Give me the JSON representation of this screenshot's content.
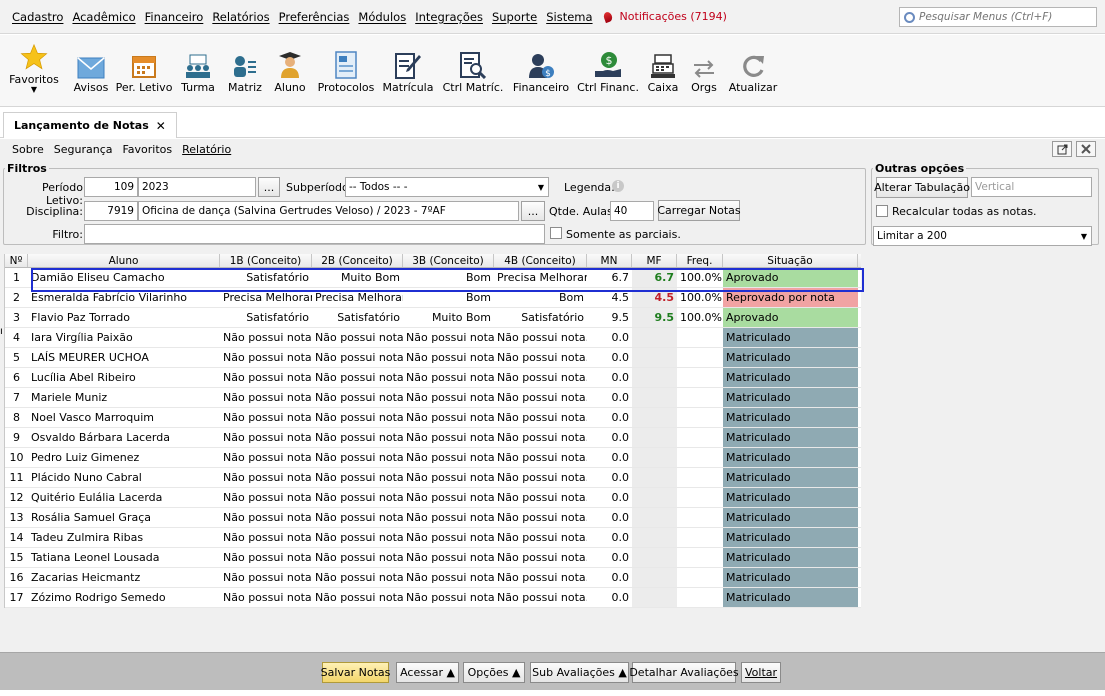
{
  "menu": {
    "items": [
      "Cadastro",
      "Acadêmico",
      "Financeiro",
      "Relatórios",
      "Preferências",
      "Módulos",
      "Integrações",
      "Suporte",
      "Sistema"
    ],
    "notifications": "Notificações (7194)",
    "search_placeholder": "Pesquisar Menus (Ctrl+F)"
  },
  "toolbar": {
    "items": [
      "Favoritos",
      "Avisos",
      "Per. Letivo",
      "Turma",
      "Matriz",
      "Aluno",
      "Protocolos",
      "Matrícula",
      "Ctrl Matríc.",
      "Financeiro",
      "Ctrl Financ.",
      "Caixa",
      "Orgs",
      "Atualizar"
    ]
  },
  "tab": {
    "label": "Lançamento de Notas",
    "close": "✕"
  },
  "submenu": [
    "Sobre",
    "Segurança",
    "Favoritos",
    "Relatório"
  ],
  "filters": {
    "legend": "Filtros",
    "periodo_label": "Período Letivo:",
    "periodo_code": "109",
    "periodo_value": "2023",
    "ellipsis": "...",
    "subperiodo_label": "Subperíodo:",
    "subperiodo_value": "-- Todos -- -",
    "legenda_label": "Legenda:",
    "disciplina_label": "Disciplina:",
    "disciplina_code": "7919",
    "disciplina_value": "Oficina de dança (Salvina Gertrudes Veloso) / 2023 - 7ºAF",
    "qtde_label": "Qtde. Aulas:",
    "qtde_value": "40",
    "carregar_label": "Carregar Notas",
    "filtro_label": "Filtro:",
    "somente_label": "Somente as parciais."
  },
  "options": {
    "legend": "Outras opções",
    "alterar_label": "Alterar Tabulação",
    "vertical_placeholder": "Vertical",
    "recalcular_label": "Recalcular todas as notas.",
    "limitar_value": "Limitar a 200"
  },
  "grid": {
    "headers": [
      "Nº",
      "Aluno",
      "1B (Conceito)",
      "2B (Conceito)",
      "3B (Conceito)",
      "4B (Conceito)",
      "MN",
      "MF",
      "Freq.",
      "Situação"
    ],
    "rows": [
      [
        "1",
        "Damião Eliseu Camacho",
        "Satisfatório",
        "Muito Bom",
        "Bom",
        "Precisa Melhorar",
        "6.7",
        "6.7",
        "100.0%",
        "Aprovado",
        "ok"
      ],
      [
        "2",
        "Esmeralda Fabrício Vilarinho",
        "Precisa Melhorar",
        "Precisa Melhorar",
        "Bom",
        "Bom",
        "4.5",
        "4.5",
        "100.0%",
        "Reprovado por nota",
        "fail"
      ],
      [
        "3",
        "Flavio Paz Torrado",
        "Satisfatório",
        "Satisfatório",
        "Muito Bom",
        "Satisfatório",
        "9.5",
        "9.5",
        "100.0%",
        "Aprovado",
        "ok"
      ],
      [
        "4",
        "Iara Virgília Paixão",
        "Não possui nota.",
        "Não possui nota.",
        "Não possui nota.",
        "Não possui nota.",
        "0.0",
        "",
        "",
        "Matriculado",
        "mat"
      ],
      [
        "5",
        "LAÍS MEURER UCHOA",
        "Não possui nota.",
        "Não possui nota.",
        "Não possui nota.",
        "Não possui nota.",
        "0.0",
        "",
        "",
        "Matriculado",
        "mat"
      ],
      [
        "6",
        "Lucília Abel Ribeiro",
        "Não possui nota.",
        "Não possui nota.",
        "Não possui nota.",
        "Não possui nota.",
        "0.0",
        "",
        "",
        "Matriculado",
        "mat"
      ],
      [
        "7",
        "Mariele Muniz",
        "Não possui nota.",
        "Não possui nota.",
        "Não possui nota.",
        "Não possui nota.",
        "0.0",
        "",
        "",
        "Matriculado",
        "mat"
      ],
      [
        "8",
        "Noel Vasco Marroquim",
        "Não possui nota.",
        "Não possui nota.",
        "Não possui nota.",
        "Não possui nota.",
        "0.0",
        "",
        "",
        "Matriculado",
        "mat"
      ],
      [
        "9",
        "Osvaldo Bárbara Lacerda",
        "Não possui nota.",
        "Não possui nota.",
        "Não possui nota.",
        "Não possui nota.",
        "0.0",
        "",
        "",
        "Matriculado",
        "mat"
      ],
      [
        "10",
        "Pedro Luiz Gimenez",
        "Não possui nota.",
        "Não possui nota.",
        "Não possui nota.",
        "Não possui nota.",
        "0.0",
        "",
        "",
        "Matriculado",
        "mat"
      ],
      [
        "11",
        "Plácido Nuno Cabral",
        "Não possui nota.",
        "Não possui nota.",
        "Não possui nota.",
        "Não possui nota.",
        "0.0",
        "",
        "",
        "Matriculado",
        "mat"
      ],
      [
        "12",
        "Quitério Eulália Lacerda",
        "Não possui nota.",
        "Não possui nota.",
        "Não possui nota.",
        "Não possui nota.",
        "0.0",
        "",
        "",
        "Matriculado",
        "mat"
      ],
      [
        "13",
        "Rosália Samuel Graça",
        "Não possui nota.",
        "Não possui nota.",
        "Não possui nota.",
        "Não possui nota.",
        "0.0",
        "",
        "",
        "Matriculado",
        "mat"
      ],
      [
        "14",
        "Tadeu Zulmira Ribas",
        "Não possui nota.",
        "Não possui nota.",
        "Não possui nota.",
        "Não possui nota.",
        "0.0",
        "",
        "",
        "Matriculado",
        "mat"
      ],
      [
        "15",
        "Tatiana Leonel Lousada",
        "Não possui nota.",
        "Não possui nota.",
        "Não possui nota.",
        "Não possui nota.",
        "0.0",
        "",
        "",
        "Matriculado",
        "mat"
      ],
      [
        "16",
        "Zacarias Heicmantz",
        "Não possui nota.",
        "Não possui nota.",
        "Não possui nota.",
        "Não possui nota.",
        "0.0",
        "",
        "",
        "Matriculado",
        "mat"
      ],
      [
        "17",
        "Zózimo Rodrigo Semedo",
        "Não possui nota.",
        "Não possui nota.",
        "Não possui nota.",
        "Não possui nota.",
        "0.0",
        "",
        "",
        "Matriculado",
        "mat"
      ]
    ]
  },
  "footer": {
    "salvar": "Salvar Notas",
    "acessar": "Acessar ▲",
    "opcoes": "Opções ▲",
    "sub": "Sub Avaliações ▲",
    "detalhar": "Detalhar Avaliações",
    "voltar": "Voltar"
  },
  "colors": {
    "approved": "#a9dca0",
    "failed": "#f1a3a3",
    "enrolled": "#8faab3",
    "pass_grade": "#1e7d1e",
    "fail_grade": "#c0202a",
    "selection": "#1f2fd2"
  }
}
